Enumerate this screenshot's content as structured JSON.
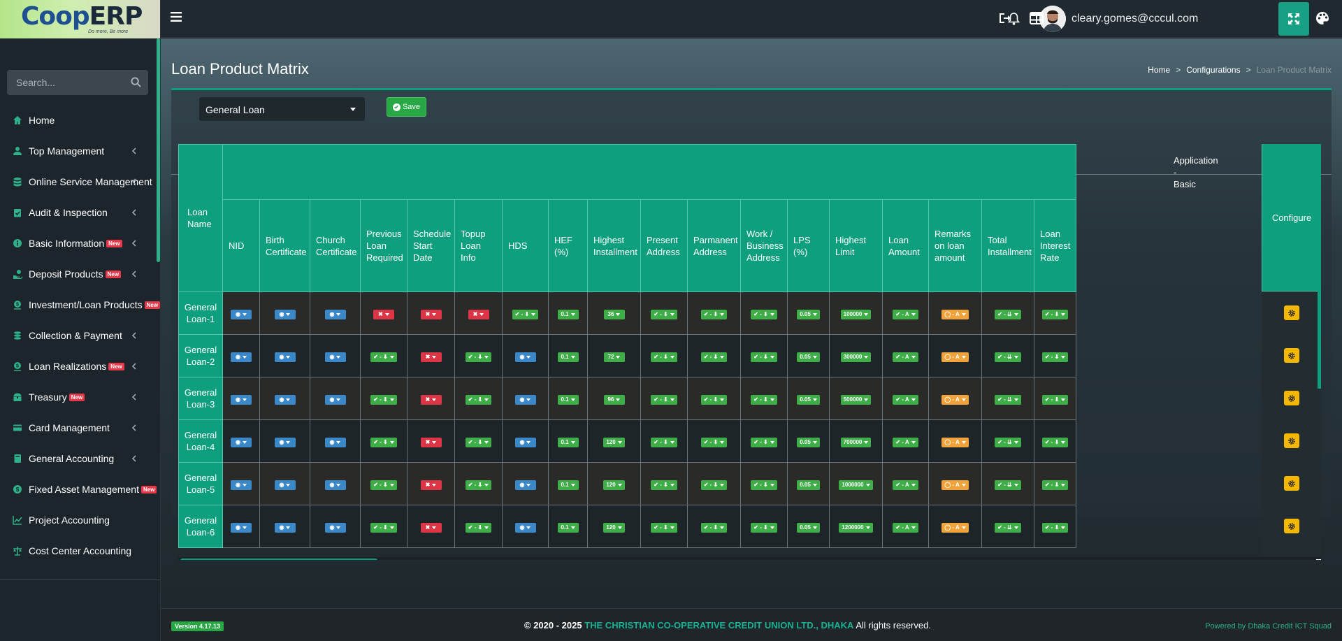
{
  "app": {
    "logo_main": "CoopERP",
    "logo_coop": "Coop",
    "logo_erp": "ERP",
    "logo_tagline": "Do more, Be more"
  },
  "sidebar": {
    "search_placeholder": "Search...",
    "new_badge": "New",
    "items": [
      {
        "label": "Home",
        "icon": "home-icon",
        "badge": false,
        "chevron": false
      },
      {
        "label": "Top Management",
        "icon": "user-tie-icon",
        "badge": false,
        "chevron": true
      },
      {
        "label": "Online Service Management",
        "icon": "database-icon",
        "badge": false,
        "chevron": true
      },
      {
        "label": "Audit & Inspection",
        "icon": "clipboard-check-icon",
        "badge": false,
        "chevron": true
      },
      {
        "label": "Basic Information",
        "icon": "info-circle-icon",
        "badge": true,
        "chevron": true
      },
      {
        "label": "Deposit Products",
        "icon": "hand-coin-icon",
        "badge": true,
        "chevron": true
      },
      {
        "label": "Investment/Loan Products",
        "icon": "dollar-circle-icon",
        "badge": true,
        "chevron": false
      },
      {
        "label": "Collection & Payment",
        "icon": "coins-icon",
        "badge": false,
        "chevron": true
      },
      {
        "label": "Loan Realizations",
        "icon": "dollar-circle-icon",
        "badge": true,
        "chevron": true
      },
      {
        "label": "Treasury",
        "icon": "treasure-chest-icon",
        "badge": true,
        "chevron": true
      },
      {
        "label": "Card Management",
        "icon": "credit-card-icon",
        "badge": false,
        "chevron": true
      },
      {
        "label": "General Accounting",
        "icon": "book-icon",
        "badge": false,
        "chevron": true
      },
      {
        "label": "Fixed Asset Management",
        "icon": "money-icon",
        "badge": true,
        "chevron": false
      },
      {
        "label": "Project Accounting",
        "icon": "chart-line-icon",
        "badge": false,
        "chevron": false
      },
      {
        "label": "Cost Center Accounting",
        "icon": "scale-icon",
        "badge": false,
        "chevron": false
      }
    ]
  },
  "topbar": {
    "user_email": "cleary.gomes@cccul.com",
    "icons": [
      "menu-icon",
      "bell-icon",
      "avatar",
      "logout-icon",
      "layout-icon",
      "fullscreen-icon",
      "palette-icon"
    ]
  },
  "page": {
    "title": "Loan Product Matrix",
    "breadcrumb": [
      "Home",
      "Configurations",
      "Loan Product Matrix"
    ],
    "breadcrumb_sep": ">"
  },
  "toolbar": {
    "select_value": "General Loan",
    "save_label": "Save"
  },
  "matrix": {
    "name_header": "Loan Name",
    "group_header": "Application - Basic",
    "configure_header": "Configure",
    "columns": [
      "NID",
      "Birth Certificate",
      "Church Certificate",
      "Previous Loan Required",
      "Schedule Start Date",
      "Topup Loan Info",
      "HDS",
      "HEF (%)",
      "Highest Installment",
      "Present Address",
      "Parmanent Address",
      "Work / Business Address",
      "LPS (%)",
      "Highest Limit",
      "Loan Amount",
      "Remarks on loan amount",
      "Total Installment",
      "Loan Interest Rate"
    ],
    "rows": [
      {
        "name": "General Loan-1",
        "cells": [
          [
            "blue",
            "◉"
          ],
          [
            "blue",
            "◉"
          ],
          [
            "blue",
            "◉"
          ],
          [
            "red",
            "✖"
          ],
          [
            "red",
            "✖"
          ],
          [
            "red",
            "✖"
          ],
          [
            "green",
            "✔ - ⬇"
          ],
          [
            "green",
            "0.1"
          ],
          [
            "green",
            "36"
          ],
          [
            "green",
            "✔ - ⬇"
          ],
          [
            "green",
            "✔ - ⬇"
          ],
          [
            "green",
            "✔ - ⬇"
          ],
          [
            "green",
            "0.05"
          ],
          [
            "green",
            "100000"
          ],
          [
            "green",
            "✔ - A"
          ],
          [
            "orange",
            "◯ - A"
          ],
          [
            "green",
            "✔ - ⇊"
          ],
          [
            "green",
            "✔ - ⬇"
          ]
        ]
      },
      {
        "name": "General Loan-2",
        "cells": [
          [
            "blue",
            "◉"
          ],
          [
            "blue",
            "◉"
          ],
          [
            "blue",
            "◉"
          ],
          [
            "green",
            "✔ - ⬇"
          ],
          [
            "red",
            "✖"
          ],
          [
            "green",
            "✔ - ⬇"
          ],
          [
            "blue",
            "◉"
          ],
          [
            "green",
            "0.1"
          ],
          [
            "green",
            "72"
          ],
          [
            "green",
            "✔ - ⬇"
          ],
          [
            "green",
            "✔ - ⬇"
          ],
          [
            "green",
            "✔ - ⬇"
          ],
          [
            "green",
            "0.05"
          ],
          [
            "green",
            "300000"
          ],
          [
            "green",
            "✔ - A"
          ],
          [
            "orange",
            "◯ - A"
          ],
          [
            "green",
            "✔ - ⇊"
          ],
          [
            "green",
            "✔ - ⬇"
          ]
        ]
      },
      {
        "name": "General Loan-3",
        "cells": [
          [
            "blue",
            "◉"
          ],
          [
            "blue",
            "◉"
          ],
          [
            "blue",
            "◉"
          ],
          [
            "green",
            "✔ - ⬇"
          ],
          [
            "red",
            "✖"
          ],
          [
            "green",
            "✔ - ⬇"
          ],
          [
            "blue",
            "◉"
          ],
          [
            "green",
            "0.1"
          ],
          [
            "green",
            "96"
          ],
          [
            "green",
            "✔ - ⬇"
          ],
          [
            "green",
            "✔ - ⬇"
          ],
          [
            "green",
            "✔ - ⬇"
          ],
          [
            "green",
            "0.05"
          ],
          [
            "green",
            "500000"
          ],
          [
            "green",
            "✔ - A"
          ],
          [
            "orange",
            "◯ - A"
          ],
          [
            "green",
            "✔ - ⇊"
          ],
          [
            "green",
            "✔ - ⬇"
          ]
        ]
      },
      {
        "name": "General Loan-4",
        "cells": [
          [
            "blue",
            "◉"
          ],
          [
            "blue",
            "◉"
          ],
          [
            "blue",
            "◉"
          ],
          [
            "green",
            "✔ - ⬇"
          ],
          [
            "red",
            "✖"
          ],
          [
            "green",
            "✔ - ⬇"
          ],
          [
            "blue",
            "◉"
          ],
          [
            "green",
            "0.1"
          ],
          [
            "green",
            "120"
          ],
          [
            "green",
            "✔ - ⬇"
          ],
          [
            "green",
            "✔ - ⬇"
          ],
          [
            "green",
            "✔ - ⬇"
          ],
          [
            "green",
            "0.05"
          ],
          [
            "green",
            "700000"
          ],
          [
            "green",
            "✔ - A"
          ],
          [
            "orange",
            "◯ - A"
          ],
          [
            "green",
            "✔ - ⇊"
          ],
          [
            "green",
            "✔ - ⬇"
          ]
        ]
      },
      {
        "name": "General Loan-5",
        "cells": [
          [
            "blue",
            "◉"
          ],
          [
            "blue",
            "◉"
          ],
          [
            "blue",
            "◉"
          ],
          [
            "green",
            "✔ - ⬇"
          ],
          [
            "red",
            "✖"
          ],
          [
            "green",
            "✔ - ⬇"
          ],
          [
            "blue",
            "◉"
          ],
          [
            "green",
            "0.1"
          ],
          [
            "green",
            "120"
          ],
          [
            "green",
            "✔ - ⬇"
          ],
          [
            "green",
            "✔ - ⬇"
          ],
          [
            "green",
            "✔ - ⬇"
          ],
          [
            "green",
            "0.05"
          ],
          [
            "green",
            "1000000"
          ],
          [
            "green",
            "✔ - A"
          ],
          [
            "orange",
            "◯ - A"
          ],
          [
            "green",
            "✔ - ⇊"
          ],
          [
            "green",
            "✔ - ⬇"
          ]
        ]
      },
      {
        "name": "General Loan-6",
        "cells": [
          [
            "blue",
            "◉"
          ],
          [
            "blue",
            "◉"
          ],
          [
            "blue",
            "◉"
          ],
          [
            "green",
            "✔ - ⬇"
          ],
          [
            "red",
            "✖"
          ],
          [
            "green",
            "✔ - ⬇"
          ],
          [
            "blue",
            "◉"
          ],
          [
            "green",
            "0.1"
          ],
          [
            "green",
            "120"
          ],
          [
            "green",
            "✔ - ⬇"
          ],
          [
            "green",
            "✔ - ⬇"
          ],
          [
            "green",
            "✔ - ⬇"
          ],
          [
            "green",
            "0.05"
          ],
          [
            "green",
            "1200000"
          ],
          [
            "green",
            "✔ - A"
          ],
          [
            "orange",
            "◯ - A"
          ],
          [
            "green",
            "✔ - ⇊"
          ],
          [
            "green",
            "✔ - ⬇"
          ]
        ]
      }
    ]
  },
  "footer": {
    "version": "Version 4.17.13",
    "copyright_prefix": "© 2020 - 2025",
    "org": "THE CHRISTIAN CO-OPERATIVE CREDIT UNION LTD., DHAKA",
    "rights": "All rights reserved.",
    "powered": "Powered by Dhaka Credit ICT Squad"
  },
  "colors": {
    "accent": "#0e9f7f",
    "badge_green": "#3fae49",
    "badge_blue": "#3a88c8",
    "badge_red": "#dc3545",
    "badge_orange": "#f0a33a",
    "configure_button": "#f5b800",
    "new_badge": "#e8394a"
  }
}
